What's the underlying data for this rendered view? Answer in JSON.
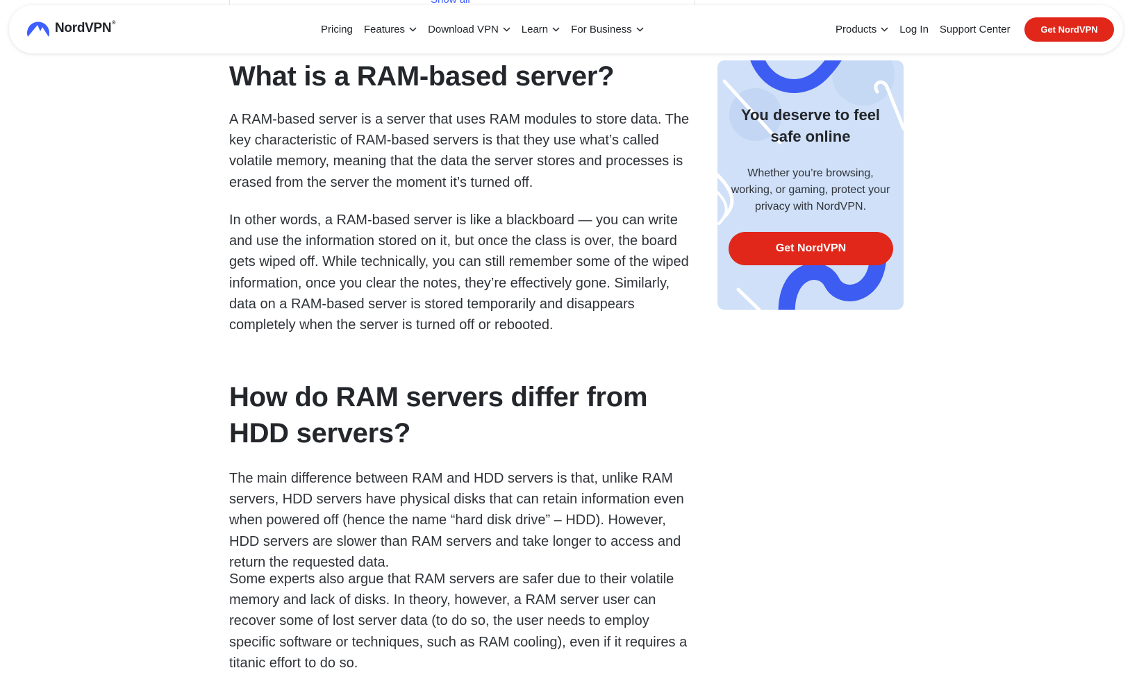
{
  "top_link": "Show all",
  "nav": {
    "brand": "NordVPN",
    "brand_mark": "®",
    "items": [
      {
        "label": "Pricing",
        "has_dropdown": false
      },
      {
        "label": "Features",
        "has_dropdown": true
      },
      {
        "label": "Download VPN",
        "has_dropdown": true
      },
      {
        "label": "Learn",
        "has_dropdown": true
      },
      {
        "label": "For Business",
        "has_dropdown": true
      }
    ],
    "right_items": [
      {
        "label": "Products",
        "has_dropdown": true
      },
      {
        "label": "Log In",
        "has_dropdown": false
      },
      {
        "label": "Support Center",
        "has_dropdown": false
      }
    ],
    "cta": "Get NordVPN"
  },
  "article": {
    "heading_1": "What is a RAM-based server?",
    "paragraph_1": "A RAM-based server is a server that uses RAM modules to store data. The key characteristic of RAM-based servers is that they use what’s called volatile memory, meaning that the data the server stores and processes is erased from the server the moment it’s turned off.",
    "paragraph_2": "In other words, a RAM-based server is like a blackboard — you can write and use the information stored on it, but once the class is over, the board gets wiped off. While technically, you can still remember some of the wiped information, once you clear the notes, they’re effectively gone. Similarly, data on a RAM-based server is stored temporarily and disappears completely when the server is turned off or rebooted.",
    "heading_2": "How do RAM servers differ from HDD servers?",
    "paragraph_3": "The main difference between RAM and HDD servers is that, unlike RAM servers, HDD servers have physical disks that can retain information even when powered off (hence the name “hard disk drive” – HDD). However, HDD servers are slower than RAM servers and take longer to access and return the requested data.",
    "paragraph_4": "Some experts also argue that RAM servers are safer due to their volatile memory and lack of disks. In theory, however, a RAM server user can recover some of lost server data (to do so, the user needs to employ specific software or techniques, such as RAM cooling), even if it requires a titanic effort to do so."
  },
  "promo": {
    "title": "You deserve to feel safe online",
    "text": "Whether you’re browsing, working, or gaming, protect your privacy with NordVPN.",
    "button": "Get NordVPN"
  },
  "colors": {
    "accent_red": "#e0271a",
    "brand_blue": "#3e5fff",
    "promo_bg": "#cfe0f8"
  }
}
